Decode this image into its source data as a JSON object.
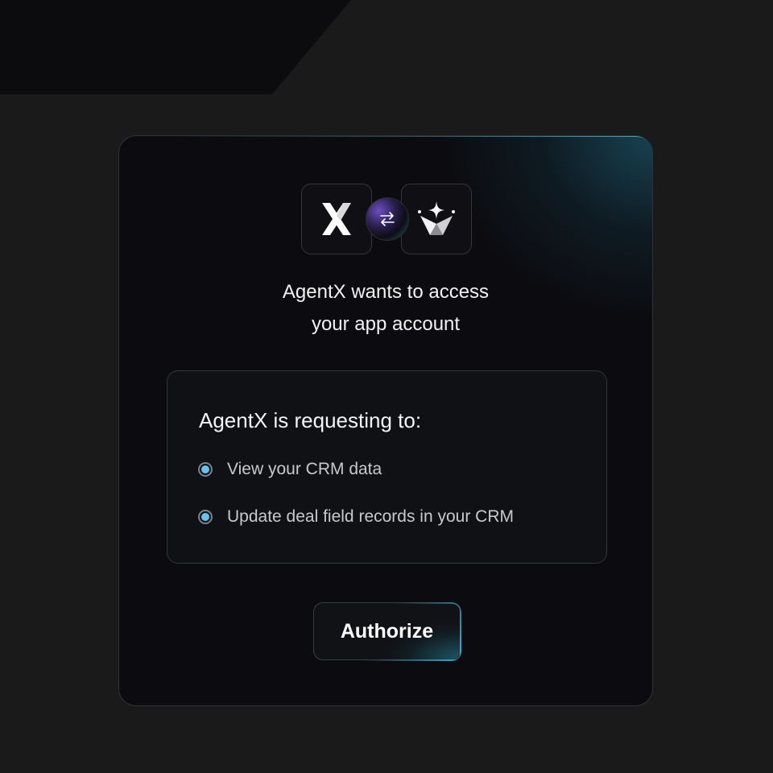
{
  "consent": {
    "heading_line1": "AgentX wants to access",
    "heading_line2": "your app account"
  },
  "logos": {
    "left_icon": "agentx-x-logo-icon",
    "swap_icon": "swap-arrows-icon",
    "right_icon": "sparkle-crown-logo-icon"
  },
  "permissions": {
    "title": "AgentX is requesting to:",
    "items": [
      {
        "label": "View your CRM data",
        "checked": true
      },
      {
        "label": "Update deal field records in your CRM",
        "checked": true
      }
    ]
  },
  "actions": {
    "authorize_label": "Authorize"
  },
  "colors": {
    "page_background": "#1a1a1a",
    "card_background": "#0c0c10",
    "accent_teal": "#3aa6c4",
    "radio_dot": "#63c3f3"
  }
}
